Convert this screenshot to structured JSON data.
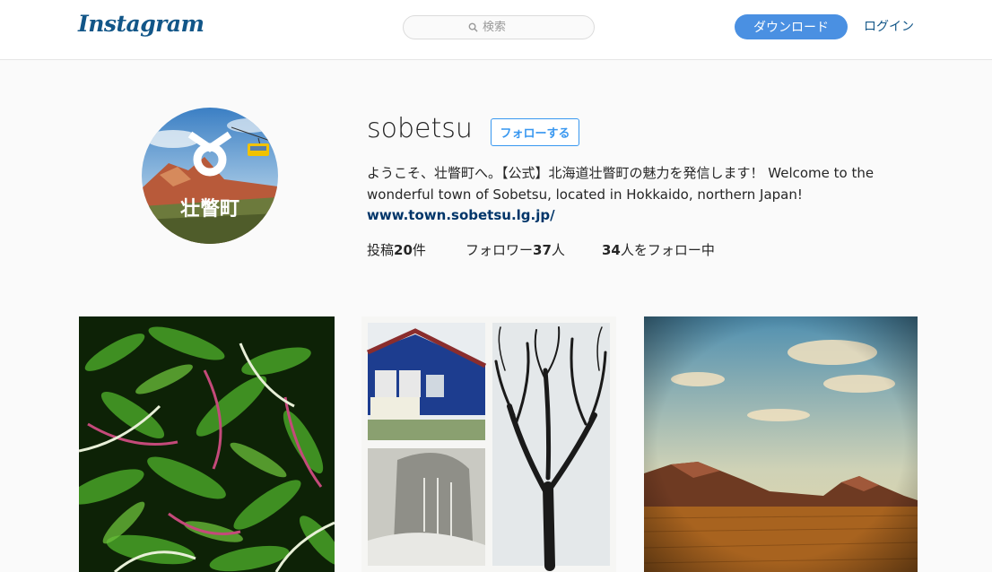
{
  "header": {
    "logo_text": "Instagram",
    "search_placeholder": "検索",
    "download_label": "ダウンロード",
    "login_label": "ログイン"
  },
  "profile": {
    "avatar_text": "壮瞥町",
    "username": "sobetsu",
    "follow_label": "フォローする",
    "bio_line1": "ようこそ、壮瞥町へ。【公式】北海道壮瞥町の魅力を発信します！ Welcome to the",
    "bio_line2": "wonderful town of Sobetsu, located in Hokkaido, northern Japan!",
    "website": "www.town.sobetsu.lg.jp/",
    "stats": {
      "posts_label": "投稿",
      "posts_count": "20",
      "posts_unit": "件",
      "followers_label": "フォロワー",
      "followers_count": "37",
      "followers_unit": "人",
      "following_count": "34",
      "following_label": "人をフォロー中"
    }
  },
  "colors": {
    "accent_blue": "#4a90e2",
    "link_blue": "#125688",
    "follow_blue": "#3897f0"
  },
  "posts": [
    {
      "subject": "green-wild-leeks"
    },
    {
      "subject": "collage-blue-house-stone-bare-tree"
    },
    {
      "subject": "volcano-field-landscape"
    }
  ]
}
